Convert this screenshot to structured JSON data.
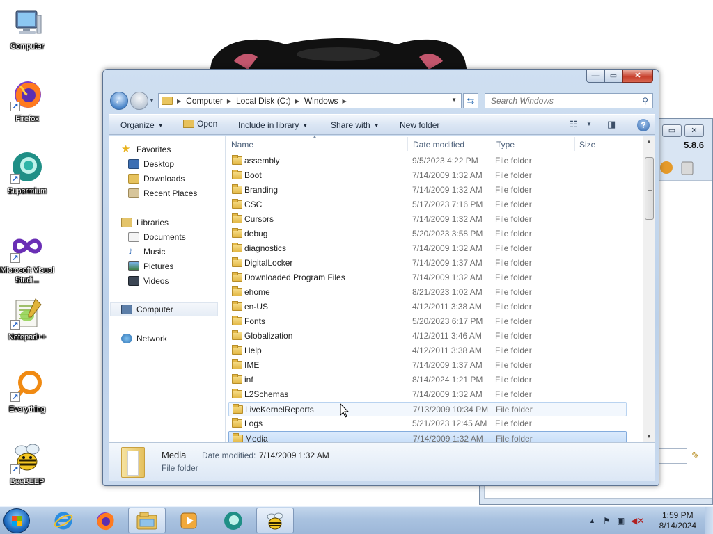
{
  "desktop": {
    "icons": [
      {
        "label": "Computer",
        "icon": "computer-icon"
      },
      {
        "label": "Firefox",
        "icon": "firefox-icon"
      },
      {
        "label": "Supermium",
        "icon": "supermium-icon"
      },
      {
        "label": "Microsoft Visual Studi...",
        "icon": "visual-studio-icon"
      },
      {
        "label": "Notepad++",
        "icon": "notepad-plus-plus-icon"
      },
      {
        "label": "Everything",
        "icon": "everything-icon"
      },
      {
        "label": "BeeBEEP",
        "icon": "beebeep-icon"
      }
    ]
  },
  "background_window": {
    "version": "5.8.6"
  },
  "explorer": {
    "caption_buttons": {
      "minimize": "—",
      "maximize": "▭",
      "close": "✕"
    },
    "breadcrumb": [
      "Computer",
      "Local Disk (C:)",
      "Windows"
    ],
    "search": {
      "placeholder": "Search Windows"
    },
    "toolbar": {
      "organize": "Organize",
      "open": "Open",
      "include_in_library": "Include in library",
      "share_with": "Share with",
      "new_folder": "New folder"
    },
    "nav": {
      "favorites_header": "Favorites",
      "favorites": [
        "Desktop",
        "Downloads",
        "Recent Places"
      ],
      "libraries_header": "Libraries",
      "libraries": [
        "Documents",
        "Music",
        "Pictures",
        "Videos"
      ],
      "computer": "Computer",
      "network": "Network"
    },
    "columns": {
      "name": "Name",
      "date_modified": "Date modified",
      "type": "Type",
      "size": "Size"
    },
    "files": [
      {
        "name": "assembly",
        "date": "9/5/2023 4:22 PM",
        "type": "File folder"
      },
      {
        "name": "Boot",
        "date": "7/14/2009 1:32 AM",
        "type": "File folder"
      },
      {
        "name": "Branding",
        "date": "7/14/2009 1:32 AM",
        "type": "File folder"
      },
      {
        "name": "CSC",
        "date": "5/17/2023 7:16 PM",
        "type": "File folder"
      },
      {
        "name": "Cursors",
        "date": "7/14/2009 1:32 AM",
        "type": "File folder"
      },
      {
        "name": "debug",
        "date": "5/20/2023 3:58 PM",
        "type": "File folder"
      },
      {
        "name": "diagnostics",
        "date": "7/14/2009 1:32 AM",
        "type": "File folder"
      },
      {
        "name": "DigitalLocker",
        "date": "7/14/2009 1:37 AM",
        "type": "File folder"
      },
      {
        "name": "Downloaded Program Files",
        "date": "7/14/2009 1:32 AM",
        "type": "File folder"
      },
      {
        "name": "ehome",
        "date": "8/21/2023 1:02 AM",
        "type": "File folder"
      },
      {
        "name": "en-US",
        "date": "4/12/2011 3:38 AM",
        "type": "File folder"
      },
      {
        "name": "Fonts",
        "date": "5/20/2023 6:17 PM",
        "type": "File folder"
      },
      {
        "name": "Globalization",
        "date": "4/12/2011 3:46 AM",
        "type": "File folder"
      },
      {
        "name": "Help",
        "date": "4/12/2011 3:38 AM",
        "type": "File folder"
      },
      {
        "name": "IME",
        "date": "7/14/2009 1:37 AM",
        "type": "File folder"
      },
      {
        "name": "inf",
        "date": "8/14/2024 1:21 PM",
        "type": "File folder"
      },
      {
        "name": "L2Schemas",
        "date": "7/14/2009 1:32 AM",
        "type": "File folder"
      },
      {
        "name": "LiveKernelReports",
        "date": "7/13/2009 10:34 PM",
        "type": "File folder",
        "state": "hover"
      },
      {
        "name": "Logs",
        "date": "5/21/2023 12:45 AM",
        "type": "File folder"
      },
      {
        "name": "Media",
        "date": "7/14/2009 1:32 AM",
        "type": "File folder",
        "state": "selected"
      }
    ],
    "details": {
      "name": "Media",
      "modified_label": "Date modified:",
      "modified_value": "7/14/2009 1:32 AM",
      "type": "File folder"
    }
  },
  "taskbar": {
    "apps": [
      "internet-explorer-icon",
      "firefox-icon",
      "windows-explorer-icon",
      "media-player-icon",
      "supermium-icon",
      "beebeep-icon"
    ],
    "active_app": "windows-explorer-icon",
    "clock": {
      "time": "1:59 PM",
      "date": "8/14/2024"
    }
  }
}
